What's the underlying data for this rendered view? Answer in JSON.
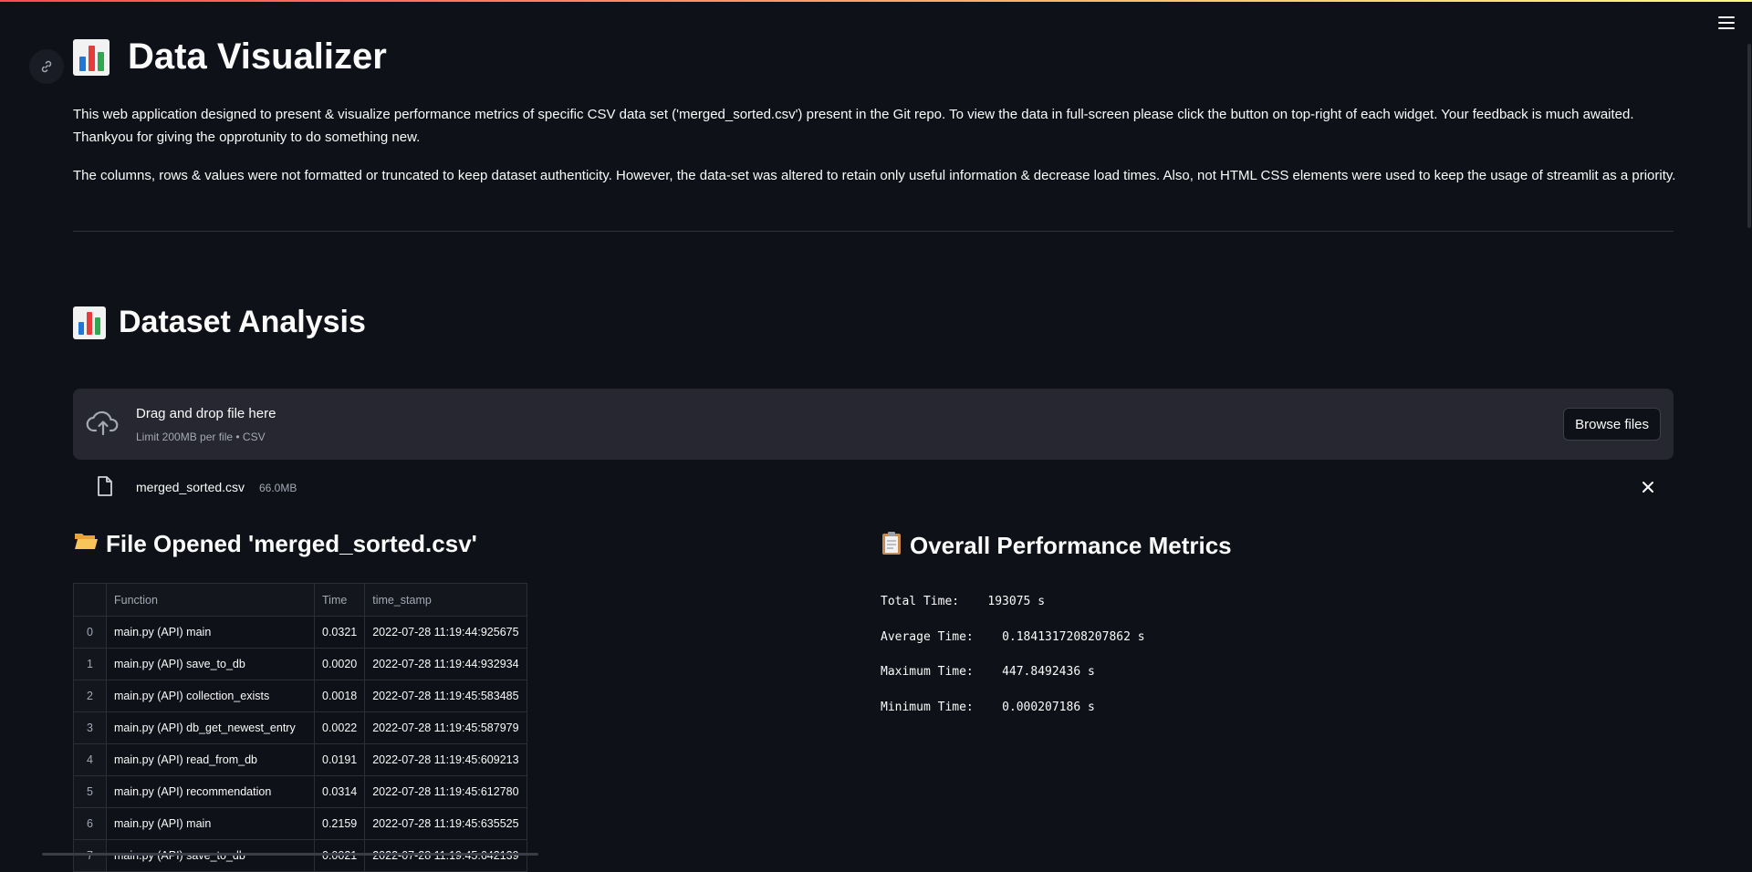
{
  "app": {
    "title": "Data Visualizer",
    "intro": [
      "This web application designed to present & visualize performance metrics of specific CSV data set ('merged_sorted.csv') present in the Git repo. To view the data in full-screen please click the button on top-right of each widget. Your feedback is much awaited. Thankyou for giving the opprotunity to do something new.",
      "The columns, rows & values were not formatted or truncated to keep dataset authenticity. However, the data-set was altered to retain only useful information & decrease load times. Also, not HTML CSS elements were used to keep the usage of streamlit as a priority."
    ]
  },
  "section": {
    "title": "Dataset Analysis"
  },
  "uploader": {
    "drag_text": "Drag and drop file here",
    "limit_text": "Limit 200MB per file • CSV",
    "browse_label": "Browse files"
  },
  "file": {
    "name": "merged_sorted.csv",
    "size": "66.0MB"
  },
  "left_panel": {
    "title": "File Opened 'merged_sorted.csv'"
  },
  "right_panel": {
    "title": "Overall Performance Metrics"
  },
  "table": {
    "columns": [
      "",
      "Function",
      "Time",
      "time_stamp"
    ],
    "rows": [
      [
        "0",
        "main.py (API) main",
        "0.0321",
        "2022-07-28 11:19:44:925675"
      ],
      [
        "1",
        "main.py (API) save_to_db",
        "0.0020",
        "2022-07-28 11:19:44:932934"
      ],
      [
        "2",
        "main.py (API) collection_exists",
        "0.0018",
        "2022-07-28 11:19:45:583485"
      ],
      [
        "3",
        "main.py (API) db_get_newest_entry",
        "0.0022",
        "2022-07-28 11:19:45:587979"
      ],
      [
        "4",
        "main.py (API) read_from_db",
        "0.0191",
        "2022-07-28 11:19:45:609213"
      ],
      [
        "5",
        "main.py (API) recommendation",
        "0.0314",
        "2022-07-28 11:19:45:612780"
      ],
      [
        "6",
        "main.py (API) main",
        "0.2159",
        "2022-07-28 11:19:45:635525"
      ],
      [
        "7",
        "main.py (API) save_to_db",
        "0.0021",
        "2022-07-28 11:19:45:642139"
      ]
    ]
  },
  "metrics": [
    {
      "label": "Total Time:",
      "value": "193075 s"
    },
    {
      "label": "Average Time:",
      "value": "0.1841317208207862 s"
    },
    {
      "label": "Maximum Time:",
      "value": "447.8492436 s"
    },
    {
      "label": "Minimum Time:",
      "value": "0.000207186 s"
    }
  ],
  "icons": [
    "link-icon",
    "bar-chart-emoji-icon",
    "cloud-upload-icon",
    "file-icon",
    "close-icon",
    "folder-open-icon",
    "clipboard-icon",
    "hamburger-menu-icon"
  ],
  "colors": {
    "background": "#0e1117",
    "panel": "#262730",
    "text": "#fafafa",
    "muted": "#a3a8b4",
    "accent": "#ff4b4b"
  }
}
